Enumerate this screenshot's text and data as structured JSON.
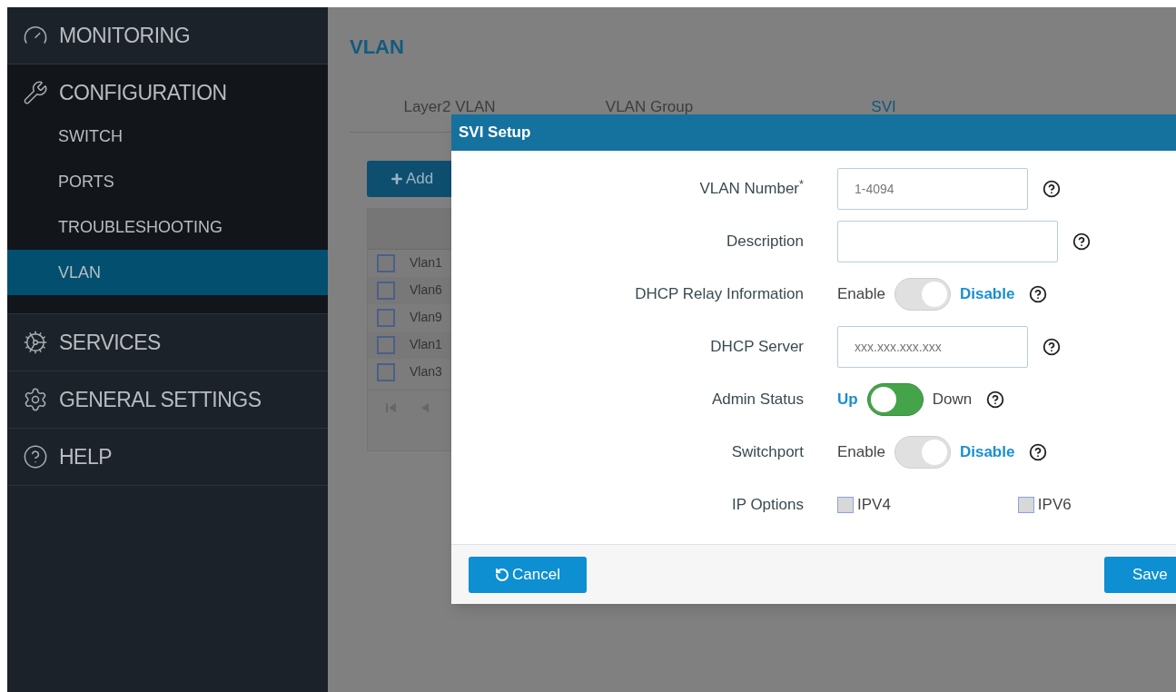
{
  "sidebar": {
    "sections": [
      {
        "label": "MONITORING",
        "expanded": false
      },
      {
        "label": "CONFIGURATION",
        "expanded": true,
        "children": [
          {
            "label": "SWITCH",
            "selected": false
          },
          {
            "label": "PORTS",
            "selected": false
          },
          {
            "label": "TROUBLESHOOTING",
            "selected": false
          },
          {
            "label": "VLAN",
            "selected": true
          }
        ]
      },
      {
        "label": "SERVICES",
        "expanded": false
      },
      {
        "label": "GENERAL SETTINGS",
        "expanded": false
      },
      {
        "label": "HELP",
        "expanded": false
      }
    ]
  },
  "page": {
    "title": "VLAN",
    "tabs": [
      {
        "label": "Layer2 VLAN",
        "selected": false
      },
      {
        "label": "VLAN Group",
        "selected": false
      },
      {
        "label": "SVI",
        "selected": true
      }
    ],
    "add_button": "Add",
    "table": {
      "rows": [
        {
          "name": "Vlan1",
          "checked": false
        },
        {
          "name": "Vlan6",
          "checked": false
        },
        {
          "name": "Vlan9",
          "checked": false
        },
        {
          "name": "Vlan1",
          "checked": false
        },
        {
          "name": "Vlan3",
          "checked": false
        }
      ]
    }
  },
  "dialog": {
    "title": "SVI Setup",
    "fields": [
      {
        "kind": "input",
        "label": "VLAN Number$^{*}$",
        "placeholder": "1-4094",
        "wide": false
      },
      {
        "kind": "input",
        "label": "Description",
        "wide": true
      },
      {
        "kind": "toggle",
        "label": "DHCP Relay Information",
        "options": [
          {
            "label": "Enable",
            "selected": false
          },
          {
            "label": "Disable",
            "selected": true
          }
        ]
      },
      {
        "kind": "input",
        "label": "DHCP Server",
        "placeholder": "xxx.xxx.xxx.xxx",
        "wide": false
      },
      {
        "kind": "toggle",
        "label": "Admin Status",
        "options": [
          {
            "label": "Up",
            "selected": true
          },
          {
            "label": "Down",
            "selected": false
          }
        ]
      },
      {
        "kind": "toggle",
        "label": "Switchport",
        "options": [
          {
            "label": "Enable",
            "selected": false
          },
          {
            "label": "Disable",
            "selected": true
          }
        ]
      },
      {
        "kind": "checkboxes",
        "label": "IP Options",
        "options": [
          {
            "label": "IPV4",
            "checked": false
          },
          {
            "label": "IPV6",
            "checked": false
          }
        ]
      }
    ],
    "buttons": {
      "cancel": "Cancel",
      "save": "Save"
    }
  }
}
